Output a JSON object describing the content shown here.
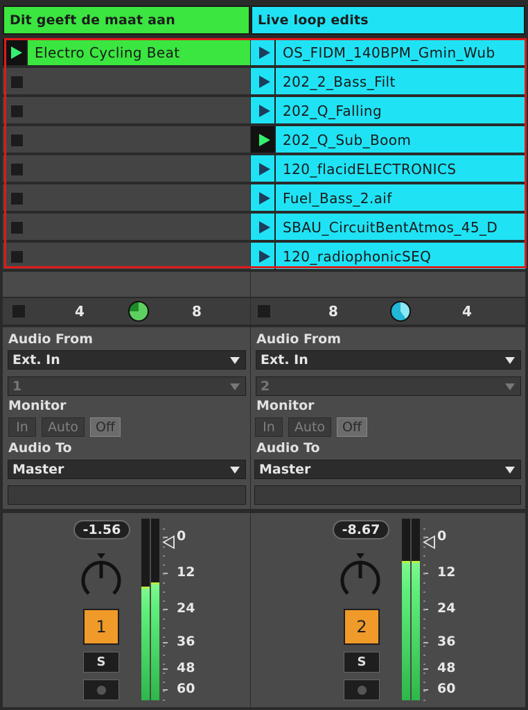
{
  "colors": {
    "track1": "#3ae63f",
    "track2": "#1fe3f5",
    "selection": "#e01a1a",
    "track_number": "#f09a2a"
  },
  "tracks": [
    {
      "name": "Dit geeft de maat aan",
      "clips": [
        {
          "name": "Electro Cycling Beat",
          "playing": true
        },
        null,
        null,
        null,
        null,
        null,
        null,
        null
      ],
      "status": {
        "left": "4",
        "right": "8",
        "pie_fraction": 0.75
      },
      "audio_from": {
        "label": "Audio From",
        "source": "Ext. In",
        "channel": "1"
      },
      "monitor": {
        "label": "Monitor",
        "options": [
          "In",
          "Auto",
          "Off"
        ],
        "selected": "Off"
      },
      "audio_to": {
        "label": "Audio To",
        "target": "Master"
      },
      "volume": "-1.56",
      "meter_levels": [
        0.62,
        0.64
      ],
      "number": "1",
      "solo_label": "S"
    },
    {
      "name": "Live loop edits",
      "clips": [
        {
          "name": "OS_FIDM_140BPM_Gmin_Wub",
          "playing": false
        },
        {
          "name": "202_2_Bass_Filt",
          "playing": false
        },
        {
          "name": "202_Q_Falling",
          "playing": false
        },
        {
          "name": "202_Q_Sub_Boom",
          "playing": true
        },
        {
          "name": "120_flacidELECTRONICS",
          "playing": false
        },
        {
          "name": "Fuel_Bass_2.aif",
          "playing": false
        },
        {
          "name": "SBAU_CircuitBentAtmos_45_D",
          "playing": false
        },
        {
          "name": "120_radiophonicSEQ",
          "playing": false
        }
      ],
      "status": {
        "left": "8",
        "right": "4",
        "pie_fraction": 0.4
      },
      "audio_from": {
        "label": "Audio From",
        "source": "Ext. In",
        "channel": "2"
      },
      "monitor": {
        "label": "Monitor",
        "options": [
          "In",
          "Auto",
          "Off"
        ],
        "selected": "Off"
      },
      "audio_to": {
        "label": "Audio To",
        "target": "Master"
      },
      "volume": "-8.67",
      "meter_levels": [
        0.76,
        0.76
      ],
      "number": "2",
      "solo_label": "S"
    }
  ],
  "meter_scale": [
    "0",
    "12",
    "24",
    "36",
    "48",
    "60"
  ]
}
